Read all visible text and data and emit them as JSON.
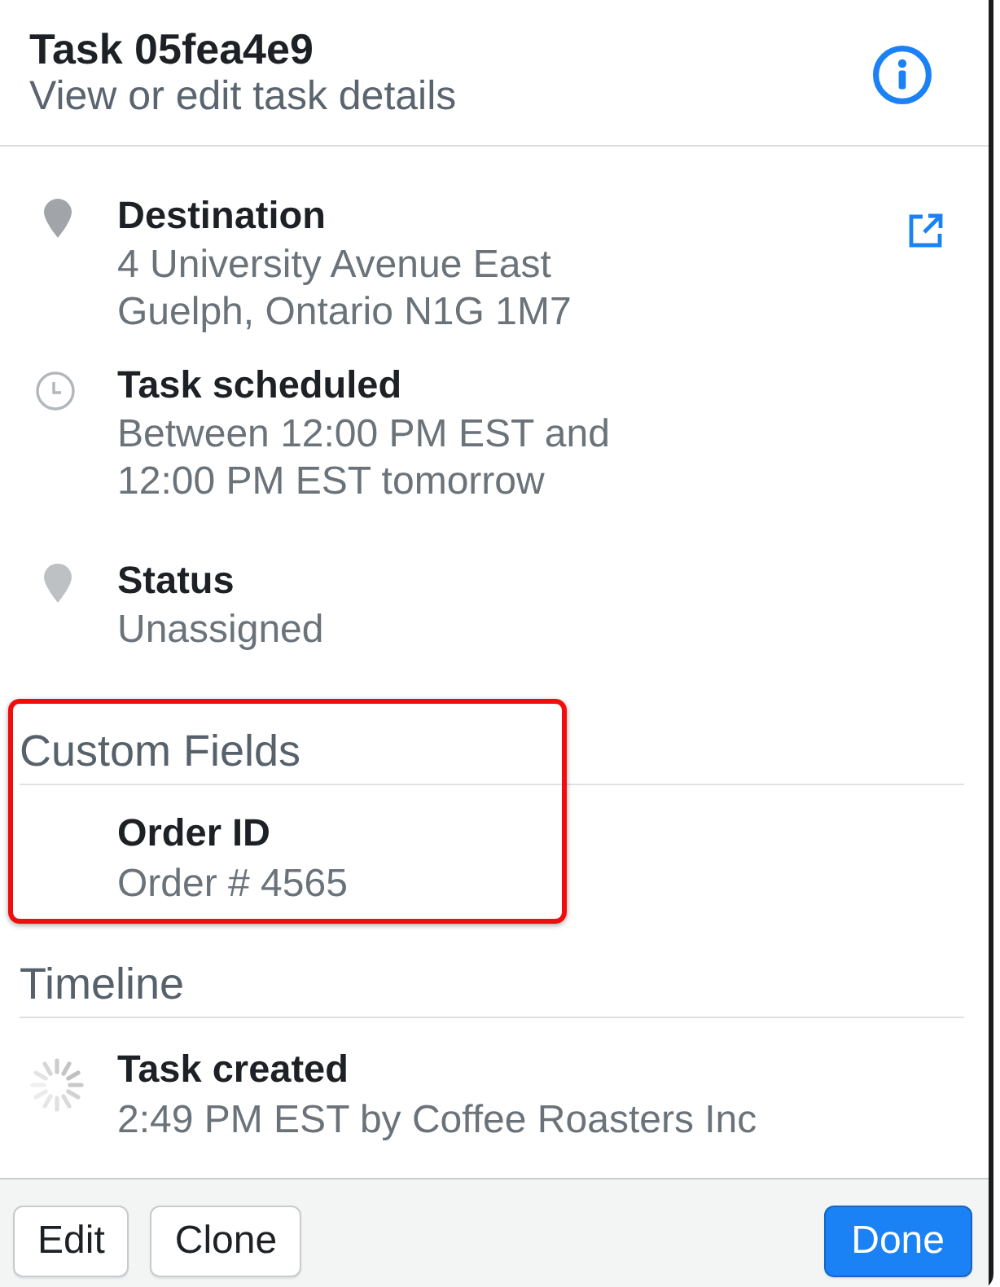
{
  "header": {
    "title": "Task 05fea4e9",
    "subtitle": "View or edit task details"
  },
  "details": [
    {
      "kind": "destination",
      "label": "Destination",
      "lines": [
        "4 University Avenue East",
        "Guelph, Ontario N1G 1M7"
      ]
    },
    {
      "kind": "schedule",
      "label": "Task scheduled",
      "lines": [
        "Between 12:00 PM EST and 12:00 PM EST tomorrow"
      ]
    },
    {
      "kind": "status",
      "label": "Status",
      "lines": [
        "Unassigned"
      ]
    }
  ],
  "custom_fields": {
    "title": "Custom Fields",
    "highlighted": true,
    "fields": [
      {
        "label": "Order ID",
        "value": "Order # 4565"
      }
    ]
  },
  "timeline": {
    "title": "Timeline",
    "events": [
      {
        "label": "Task created",
        "detail": "2:49 PM EST by Coffee Roasters Inc"
      }
    ]
  },
  "footer": {
    "buttons": [
      {
        "label": "Edit",
        "kind": "secondary"
      },
      {
        "label": "Clone",
        "kind": "secondary"
      },
      {
        "label": "Done",
        "kind": "primary"
      }
    ]
  }
}
